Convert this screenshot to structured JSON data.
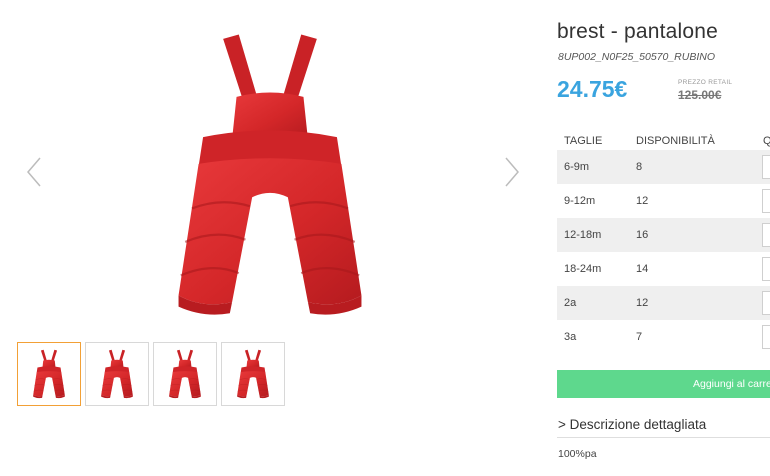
{
  "product": {
    "title": "brest - pantalone",
    "sku": "8UP002_N0F25_50570_RUBINO",
    "price": "24.75€",
    "retail_label": "PREZZO RETAIL",
    "retail_price": "125.00€"
  },
  "gallery": {
    "prev_icon": "chevron-left-icon",
    "next_icon": "chevron-right-icon",
    "thumbnail_count": 4,
    "active_thumbnail": 1
  },
  "sizes_table": {
    "headers": {
      "size": "TAGLIE",
      "availability": "DISPONIBILITÀ",
      "quantity": "Q"
    },
    "rows": [
      {
        "size": "6-9m",
        "availability": "8"
      },
      {
        "size": "9-12m",
        "availability": "12"
      },
      {
        "size": "12-18m",
        "availability": "16"
      },
      {
        "size": "18-24m",
        "availability": "14"
      },
      {
        "size": "2a",
        "availability": "12"
      },
      {
        "size": "3a",
        "availability": "7"
      }
    ]
  },
  "actions": {
    "add_to_cart": "Aggiungi al carrello"
  },
  "description": {
    "toggle_label": "> Descrizione dettagliata",
    "text": "100%pa"
  },
  "colors": {
    "price": "#3aa4df",
    "cart_button": "#5ed88d",
    "active_thumb_border": "#f2a036",
    "garment": "#d8282c"
  }
}
